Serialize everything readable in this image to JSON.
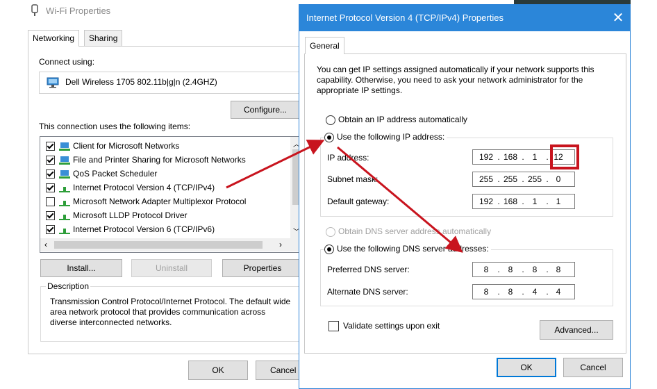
{
  "wifi": {
    "title": "Wi-Fi Properties",
    "tabs": [
      "Networking",
      "Sharing"
    ],
    "connect_using_label": "Connect using:",
    "adapter": "Dell Wireless 1705 802.11b|g|n (2.4GHZ)",
    "configure_label": "Configure...",
    "items_label": "This connection uses the following items:",
    "items": [
      {
        "label": "Client for Microsoft Networks",
        "checked": true
      },
      {
        "label": "File and Printer Sharing for Microsoft Networks",
        "checked": true
      },
      {
        "label": "QoS Packet Scheduler",
        "checked": true
      },
      {
        "label": "Internet Protocol Version 4 (TCP/IPv4)",
        "checked": true
      },
      {
        "label": "Microsoft Network Adapter Multiplexor Protocol",
        "checked": false
      },
      {
        "label": "Microsoft LLDP Protocol Driver",
        "checked": true
      },
      {
        "label": "Internet Protocol Version 6 (TCP/IPv6)",
        "checked": true
      }
    ],
    "install_label": "Install...",
    "uninstall_label": "Uninstall",
    "properties_label": "Properties",
    "description_label": "Description",
    "description_text": "Transmission Control Protocol/Internet Protocol. The default wide area network protocol that provides communication across diverse interconnected networks.",
    "ok_label": "OK",
    "cancel_label": "Cancel"
  },
  "ipv4": {
    "title": "Internet Protocol Version 4 (TCP/IPv4) Properties",
    "close_glyph": "✕",
    "tab": "General",
    "intro": "You can get IP settings assigned automatically if your network supports this capability. Otherwise, you need to ask your network administrator for the appropriate IP settings.",
    "obtain_ip_label": "Obtain an IP address automatically",
    "use_ip_label": "Use the following IP address:",
    "ip_address_label": "IP address:",
    "ip_address": [
      "192",
      "168",
      "1",
      "12"
    ],
    "subnet_label": "Subnet mask:",
    "subnet": [
      "255",
      "255",
      "255",
      "0"
    ],
    "gateway_label": "Default gateway:",
    "gateway": [
      "192",
      "168",
      "1",
      "1"
    ],
    "obtain_dns_label": "Obtain DNS server address automatically",
    "use_dns_label": "Use the following DNS server addresses:",
    "preferred_dns_label": "Preferred DNS server:",
    "preferred_dns": [
      "8",
      "8",
      "8",
      "8"
    ],
    "alternate_dns_label": "Alternate DNS server:",
    "alternate_dns": [
      "8",
      "8",
      "4",
      "4"
    ],
    "validate_label": "Validate settings upon exit",
    "advanced_label": "Advanced...",
    "ok_label": "OK",
    "cancel_label": "Cancel"
  },
  "colors": {
    "titlebar_blue": "#2b86d9",
    "annotation_red": "#c8141e",
    "focus_blue": "#0078d7"
  }
}
